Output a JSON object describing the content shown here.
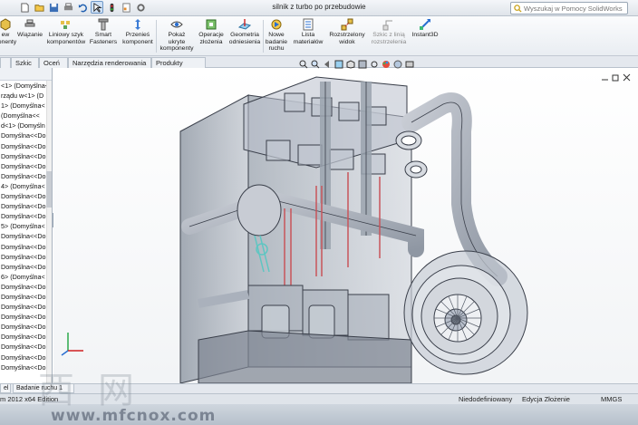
{
  "app": {
    "document_title": "silnik z turbo po przebudowie",
    "search_placeholder": "Wyszukaj w Pomocy SolidWorks"
  },
  "quick_access": [
    "new-icon",
    "open-icon",
    "save-icon",
    "print-icon",
    "undo-icon",
    "select-icon",
    "rebuild-icon",
    "file-properties-icon",
    "options-icon"
  ],
  "ribbon": {
    "buttons": [
      {
        "name": "new-view",
        "label": "ew\nponenty",
        "icon": "component-icon"
      },
      {
        "name": "mate",
        "label": "Wiązanie",
        "icon": "mate-icon"
      },
      {
        "name": "linear-pattern",
        "label": "Liniowy szyk\nkomponentów",
        "icon": "pattern-icon"
      },
      {
        "name": "smart-fasteners",
        "label": "Smart\nFasteners",
        "icon": "fastener-icon"
      },
      {
        "name": "move-component",
        "label": "Przenieś\nkomponent",
        "icon": "move-icon"
      },
      {
        "name": "show-hidden",
        "label": "Pokaż\nukryte\nkomponenty",
        "icon": "eye-icon"
      },
      {
        "name": "assembly-features",
        "label": "Operacje\nzłożenia",
        "icon": "features-icon"
      },
      {
        "name": "reference-geometry",
        "label": "Geometria\nodniesienia",
        "icon": "geometry-icon"
      },
      {
        "name": "new-motion-study",
        "label": "Nowe\nbadanie\nruchu",
        "icon": "motion-icon"
      },
      {
        "name": "bill-of-materials",
        "label": "Lista\nmateriałów",
        "icon": "bom-icon"
      },
      {
        "name": "exploded-view",
        "label": "Rozstrzelony\nwidok",
        "icon": "explode-icon"
      },
      {
        "name": "explode-line-sketch",
        "label": "Szkic z linią\nrozstrzelenia",
        "icon": "explode-line-icon"
      },
      {
        "name": "instant3d",
        "label": "Instant3D",
        "icon": "instant3d-icon"
      }
    ]
  },
  "tabs": [
    {
      "label": "Szkic"
    },
    {
      "label": "Oceń"
    },
    {
      "label": "Narzędzia renderowania"
    },
    {
      "label": "Produkty Office"
    }
  ],
  "feature_tree": {
    "items": [
      "<1> (Domyślna<",
      "rządu w<1> (D",
      "1> (Domyślna<",
      "(Domyślna<<",
      "d<1> (Domyśln",
      "Domyślna<<Do",
      "Domyślna<<Do",
      "Domyślna<<Do",
      "Domyślna<<Do",
      "Domyślna<<Do",
      "4> (Domyślna<",
      "Domyślna<<Do",
      "Domyślna<<Do",
      "Domyślna<<Do",
      "5> (Domyślna<",
      "Domyślna<<Do",
      "Domyślna<<Do",
      "Domyślna<<Do",
      "Domyślna<<Do",
      "6> (Domyślna<",
      "Domyślna<<Do",
      "Domyślna<<Do",
      "Domyślna<<Do",
      "Domyślna<<Do",
      "Domyślna<<Do",
      "Domyślna<<Do",
      "Domyślna<<Do",
      "Domyślna<<Do",
      "Domyślna<<Do"
    ]
  },
  "bottom_tabs": [
    "el",
    "Badanie ruchu 1"
  ],
  "status": {
    "edition": "m 2012 x64 Edition",
    "constraint": "Niedodefiniowany",
    "mode": "Edycja Złożenie",
    "units": "MMGS"
  },
  "watermark": {
    "domain": "www.mfcnox.com",
    "chinese": "西网"
  },
  "colors": {
    "ribbon_bg": "#e9edf2",
    "viewport_bg": "#f2f4f6",
    "engine_gray": "#b9c0cc",
    "engine_edge": "#3a3f4a",
    "piston_red": "#c8545a",
    "turbo_cyan": "#5fc6c2"
  }
}
